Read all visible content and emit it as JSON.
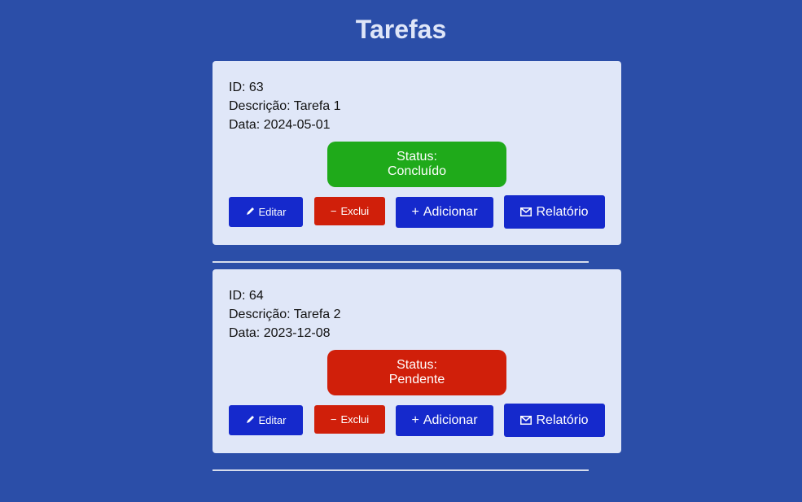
{
  "page": {
    "title": "Tarefas"
  },
  "colors": {
    "background": "#2b4ea8",
    "card": "#e0e7f8",
    "status_done": "#1faa1a",
    "status_pending": "#d01f0a",
    "primary_button": "#1529cc",
    "danger_button": "#d01f0a"
  },
  "buttons": {
    "edit_label": "Editar",
    "delete_label": "Exclui",
    "add_label": "Adicionar",
    "report_label": "Relatório",
    "edit_icon": "pencil-icon",
    "delete_icon": "minus-icon",
    "add_icon": "plus-icon",
    "report_icon": "envelope-icon"
  },
  "tasks": [
    {
      "id_text": "ID: 63",
      "description_text": "Descrição: Tarefa 1",
      "date_text": "Data: 2024-05-01",
      "status_label": "Status:",
      "status_value": "Concluído",
      "status_color": "#1faa1a"
    },
    {
      "id_text": "ID: 64",
      "description_text": "Descrição: Tarefa 2",
      "date_text": "Data: 2023-12-08",
      "status_label": "Status:",
      "status_value": "Pendente",
      "status_color": "#d01f0a"
    }
  ]
}
